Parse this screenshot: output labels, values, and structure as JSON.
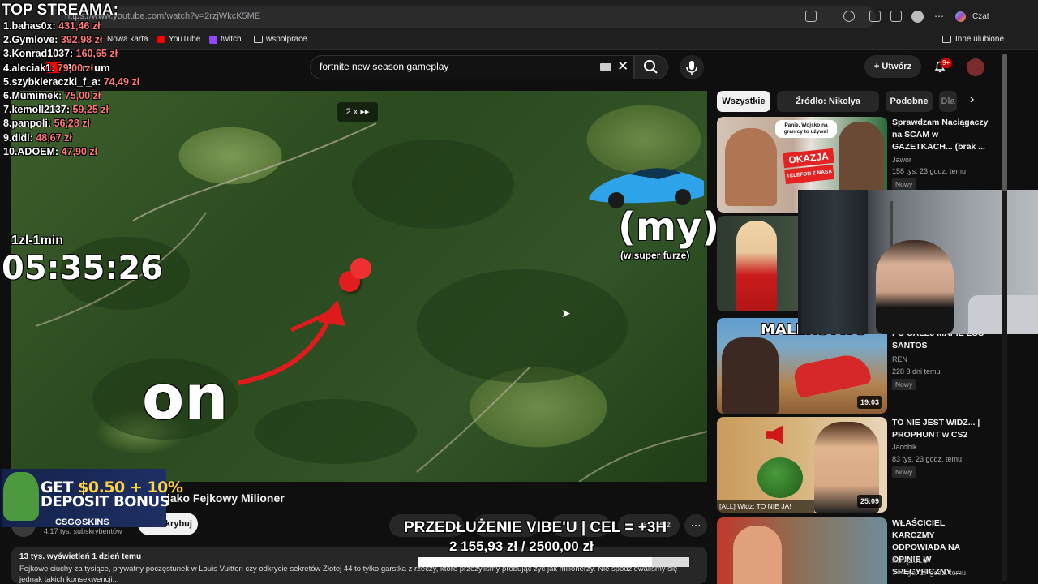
{
  "browser": {
    "url": "https://www.youtube.com/watch?v=2rzjWkcK5ME",
    "copilot_label": "Czat",
    "bookmarks": [
      "Nowa karta",
      "YouTube",
      "twitch",
      "wspolprace"
    ],
    "other_bookmarks": "Inne ulubione"
  },
  "youtube": {
    "logo": "Premium",
    "search_value": "fortnite new season gameplay",
    "create_label": "Utwórz",
    "notification_count": "9+"
  },
  "overlay": {
    "title": "TOP STREAMA:",
    "top_list": [
      {
        "rank": "1.",
        "name": "bahas0x:",
        "amount": "431,46 zł"
      },
      {
        "rank": "2.",
        "name": "Gymlove:",
        "amount": "392,98 zł"
      },
      {
        "rank": "3.",
        "name": "Konrad1037:",
        "amount": "160,65 zł"
      },
      {
        "rank": "4.",
        "name": "aleciak1:",
        "amount": "79,00 zł"
      },
      {
        "rank": "5.",
        "name": "szybkieraczki_f_a:",
        "amount": "74,49 zł"
      },
      {
        "rank": "6.",
        "name": "Mumimek:",
        "amount": "75,00 zł"
      },
      {
        "rank": "7.",
        "name": "kemoll2137:",
        "amount": "59,25 zł"
      },
      {
        "rank": "8.",
        "name": "panpoli:",
        "amount": "56,28 zł"
      },
      {
        "rank": "9.",
        "name": "didi:",
        "amount": "48,67 zł"
      },
      {
        "rank": "10.",
        "name": "ADOEM:",
        "amount": "47,90 zł"
      }
    ],
    "timer_label": "1zl-1min",
    "timer": "05:35:26",
    "goal_title": "PRZEDŁUŻENIE VIBE'U | CEL = +3H",
    "goal_amount": "2 155,93 zł / 2500,00 zł",
    "goal_progress": 0.862
  },
  "video": {
    "speed": "2 x",
    "text_on": "on",
    "text_my": "(my)",
    "text_my_sub": "(w super furze)",
    "title": "jako Fejkowy Milioner",
    "subscribers": "4,17 tys. subskrybentów",
    "subscribe_label": "Subskrybuj",
    "download_label": "Pobierz",
    "views_date": "13 tys. wyświetleń  1 dzień temu",
    "description": "Fejkowe ciuchy za tysiące, prywatny poczęstunek w Louis Vuitton czy odkrycie sekretów Złotej 44 to tylko garstka z rzeczy, które przeżyliśmy próbując żyć jak milionerzy. Nie spodziewaliśmy się jednak takich konsekwencji..."
  },
  "ad": {
    "line1_a": "GET ",
    "line1_b": "$0.50 + 10%",
    "line2": "DEPOSIT BONUS",
    "brand": "CSG⊙SKINS"
  },
  "sidebar": {
    "chips": [
      "Wszystkie",
      "Źródło: Nikolya Wąchała",
      "Podobne",
      "Dla"
    ],
    "videos": [
      {
        "title": "Sprawdzam Naciągaczy na SCAM w GAZETKACH... (brak ...",
        "channel": "Jawor",
        "meta": "158 tys.  23 godz. temu",
        "badge": "Nowy",
        "duration": ""
      },
      {
        "title": "",
        "channel": "",
        "meta": "",
        "badge": "",
        "duration": ""
      },
      {
        "title": "PO CAŁEJ MAPIE LOS SANTOS",
        "channel": "REN",
        "meta": "228  3 dni temu",
        "badge": "Nowy",
        "duration": "19:03"
      },
      {
        "title": "TO NIE JEST WIDZ... | PROPHUNT w CS2",
        "channel": "Jacobik",
        "meta": "83 tys.  23 godz. temu",
        "badge": "Nowy",
        "duration": "25:09",
        "thumb_caption": "[ALL] Widz: TO NIE JA!"
      },
      {
        "title": "WŁAŚCICIEL KARCZMY ODPOWIADA NA OPINIE W SPECYFICZNY ...",
        "channel": "KSIĄŻULO",
        "meta": "744 tys.  17 godz. temu",
        "badge": "",
        "duration": ""
      }
    ],
    "thumb1_sticker": "OKAZJA",
    "thumb1_sticker_sub": "TELEFON Z NASA",
    "thumb1_bubble": "Panie, Wojsko na granicy to używa!",
    "thumb3_text": "MALEŃSTWO"
  },
  "colors": {
    "accent": "#ff0000",
    "amount": "#ff7676",
    "goal_bar": "#ffffff"
  }
}
